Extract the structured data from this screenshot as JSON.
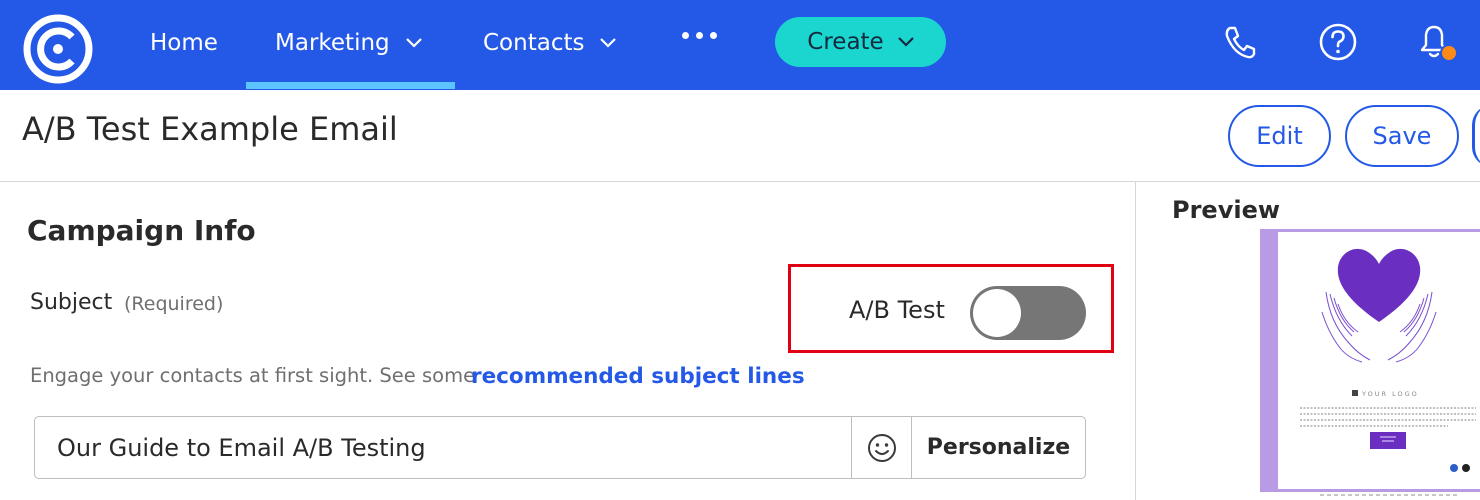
{
  "nav": {
    "items": [
      {
        "label": "Home"
      },
      {
        "label": "Marketing"
      },
      {
        "label": "Contacts"
      }
    ],
    "create_label": "Create",
    "active_color": "#5cc4ff",
    "bar_color": "#2458e6",
    "icons": [
      "logo-icon",
      "phone-icon",
      "help-icon",
      "bell-icon"
    ],
    "notification_badge_color": "#ff8a16"
  },
  "header": {
    "title": "A/B Test Example Email",
    "edit_label": "Edit",
    "save_label": "Save"
  },
  "campaign": {
    "section_title": "Campaign Info",
    "subject_label": "Subject",
    "subject_required": "(Required)",
    "ab_test_label": "A/B Test",
    "ab_test_enabled": false,
    "helper_text": "Engage your contacts at first sight. See some",
    "helper_link": "recommended subject lines",
    "subject_value": "Our Guide to Email A/B Testing",
    "personalize_label": "Personalize",
    "highlight_color": "#e00012"
  },
  "preview": {
    "title": "Preview",
    "logo_text": "YOUR LOGO",
    "accent_color": "#6a2fc0"
  }
}
